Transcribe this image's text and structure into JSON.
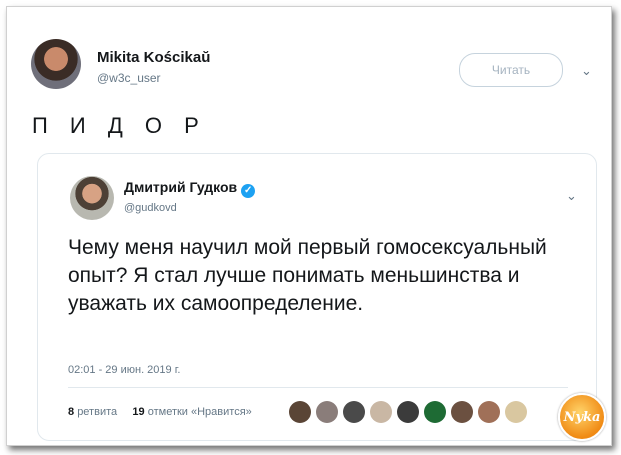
{
  "tweet": {
    "author_name": "Mikita Kościkaŭ",
    "author_handle": "@w3c_user",
    "follow_label": "Читать",
    "text": "П И Д О Р"
  },
  "quoted": {
    "author_name": "Дмитрий Гудков",
    "author_handle": "@gudkovd",
    "text": "Чему меня научил мой первый гомосексуальный опыт? Я стал лучше понимать меньшинства и уважать их самоопределение.",
    "date": "02:01 - 29 июн. 2019 г.",
    "retweets_count": "8",
    "retweets_label": "ретвита",
    "likes_count": "19",
    "likes_label": "отметки «Нравится»"
  },
  "colors": {
    "verified": "#1da1f2",
    "secondary_text": "#657786",
    "border": "#e1e8ed"
  },
  "icons": {
    "menu": "chevron-down-icon",
    "verified": "verified-badge-icon"
  },
  "watermark": {
    "text": "Nyka"
  }
}
